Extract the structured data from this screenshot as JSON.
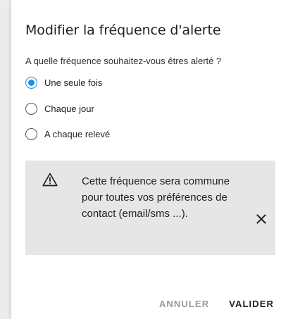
{
  "dialog": {
    "title": "Modifier la fréquence d'alerte",
    "question": "A quelle fréquence souhaitez-vous êtres alerté ?",
    "options": [
      {
        "label": "Une seule fois",
        "selected": true
      },
      {
        "label": "Chaque jour",
        "selected": false
      },
      {
        "label": "A chaque relevé",
        "selected": false
      }
    ],
    "notice": {
      "icon": "warning-icon",
      "text": "Cette fréquence sera commune pour toutes vos préférences de contact (email/sms ...).",
      "close_icon": "close-icon"
    },
    "actions": {
      "cancel_label": "ANNULER",
      "confirm_label": "VALIDER"
    }
  },
  "colors": {
    "accent": "#1a8fe3",
    "notice_bg": "#e6e6e6",
    "cancel_text": "#9a9a9a"
  }
}
